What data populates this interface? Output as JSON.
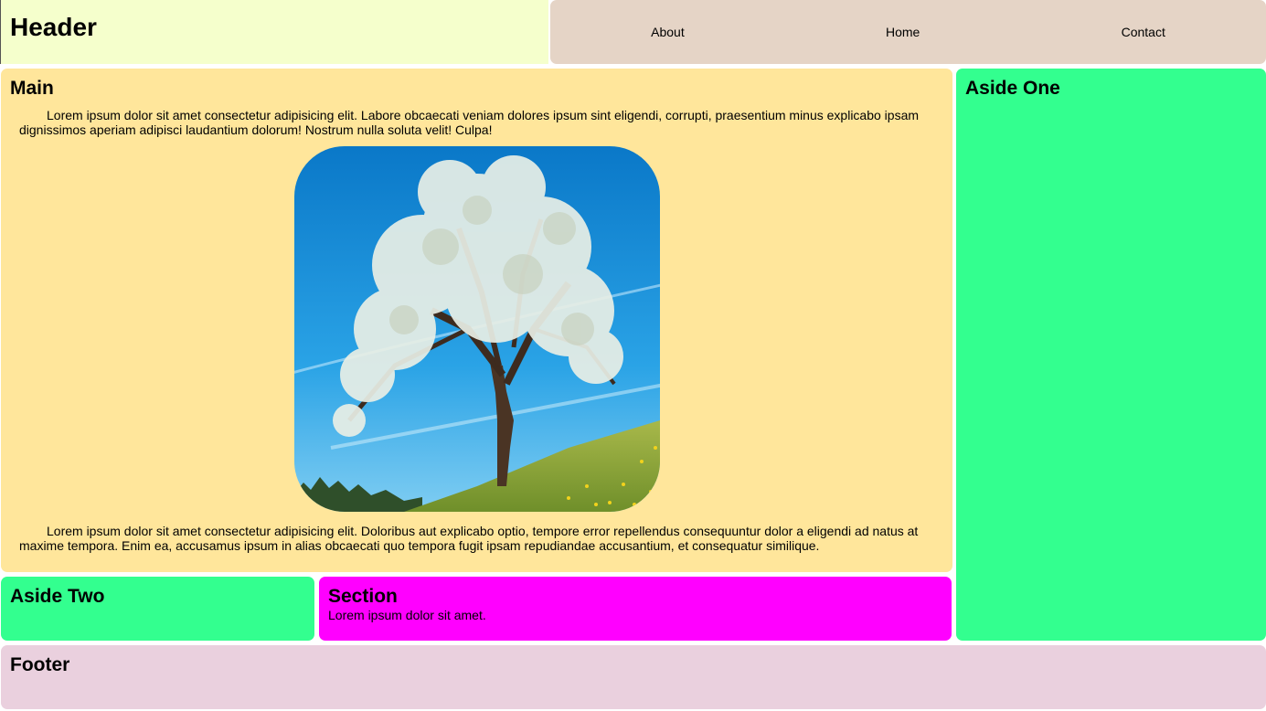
{
  "header": {
    "title": "Header"
  },
  "nav": {
    "links": [
      "About",
      "Home",
      "Contact"
    ]
  },
  "main": {
    "title": "Main",
    "paragraph_1": "Lorem ipsum dolor sit amet consectetur adipisicing elit. Labore obcaecati veniam dolores ipsum sint eligendi, corrupti, praesentium minus explicabo ipsam dignissimos aperiam adipisci laudantium dolorum! Nostrum nulla soluta velit! Culpa!",
    "image": "flowering-tree-photo",
    "paragraph_2": "Lorem ipsum dolor sit amet consectetur adipisicing elit. Doloribus aut explicabo optio, tempore error repellendus consequuntur dolor a eligendi ad natus at maxime tempora. Enim ea, accusamus ipsum in alias obcaecati quo tempora fugit ipsam repudiandae accusantium, et consequatur similique."
  },
  "aside_one": {
    "title": "Aside One"
  },
  "aside_two": {
    "title": "Aside Two"
  },
  "section": {
    "title": "Section",
    "text": "Lorem ipsum dolor sit amet."
  },
  "footer": {
    "title": "Footer"
  },
  "colors": {
    "header_bg": "#f5ffcc",
    "nav_bg": "#e5d4c6",
    "main_bg": "#ffe69b",
    "aside_bg": "#33ff8f",
    "section_bg": "#ff00ff",
    "footer_bg": "#ead0de"
  }
}
